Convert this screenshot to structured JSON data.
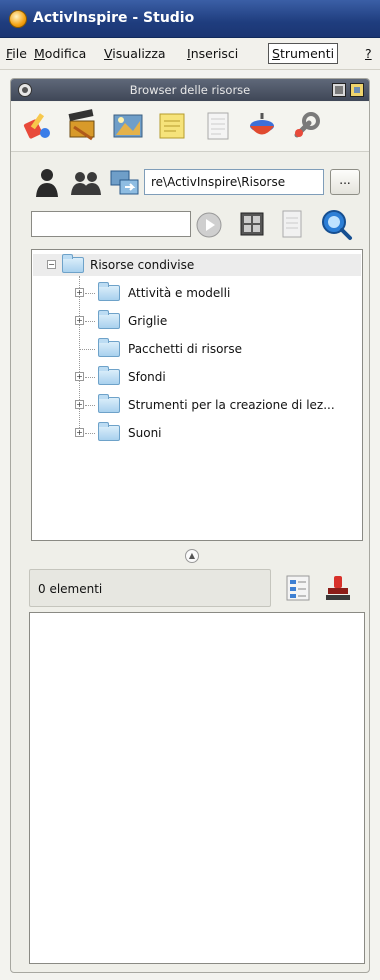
{
  "window": {
    "title": "ActivInspire - Studio"
  },
  "menubar": {
    "items": [
      {
        "label_ul": "F",
        "label_rest": "ile"
      },
      {
        "label_ul": "M",
        "label_rest": "odifica"
      },
      {
        "label_ul": "V",
        "label_rest": "isualizza"
      },
      {
        "label_ul": "I",
        "label_rest": "nserisci"
      },
      {
        "label_ul": "S",
        "label_rest": "trumenti"
      },
      {
        "label_ul": "?",
        "label_rest": ""
      }
    ]
  },
  "panel": {
    "title": "Browser delle risorse",
    "categories": [
      "paint-brush-icon",
      "film-clapper-icon",
      "scene-tools-icon",
      "sticky-notes-icon",
      "document-icon",
      "spinning-top-icon",
      "wrench-icon"
    ]
  },
  "path": {
    "value": "re\\ActivInspire\\Risorse",
    "browse_label": "..."
  },
  "search": {
    "value": ""
  },
  "tree": {
    "root": "Risorse condivise",
    "children": [
      {
        "label": "Attività e modelli",
        "expandable": true
      },
      {
        "label": "Griglie",
        "expandable": true
      },
      {
        "label": "Pacchetti di risorse",
        "expandable": false
      },
      {
        "label": "Sfondi",
        "expandable": true
      },
      {
        "label": "Strumenti per la creazione di lez...",
        "expandable": true
      },
      {
        "label": "Suoni",
        "expandable": true
      }
    ]
  },
  "results": {
    "count_label": "0 elementi"
  },
  "colors": {
    "titlebar": "#1f3d7e",
    "panel_header": "#4b5366",
    "folder": "#a9d1ee"
  }
}
